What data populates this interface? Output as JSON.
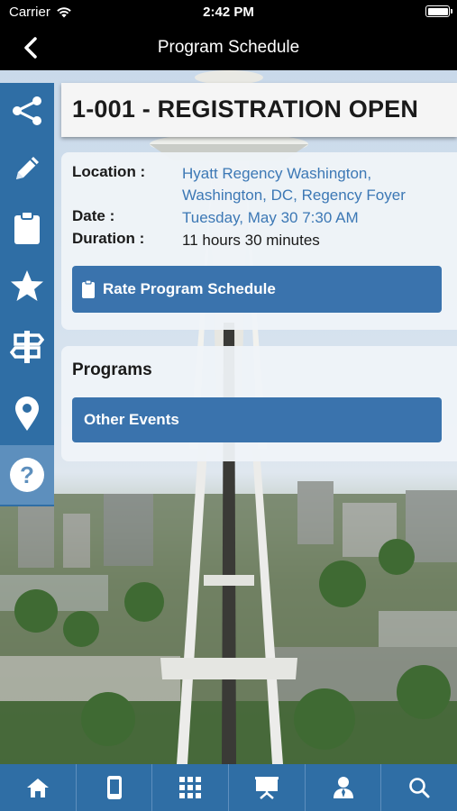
{
  "status_bar": {
    "carrier": "Carrier",
    "time": "2:42 PM"
  },
  "nav": {
    "title": "Program Schedule",
    "back_icon": "chevron-left-icon"
  },
  "side_rail": [
    {
      "icon": "share-icon"
    },
    {
      "icon": "pencil-icon"
    },
    {
      "icon": "clipboard-icon"
    },
    {
      "icon": "star-icon"
    },
    {
      "icon": "signpost-icon"
    },
    {
      "icon": "map-pin-icon"
    },
    {
      "icon": "help-icon",
      "active": true
    }
  ],
  "session": {
    "title": "1-001 - REGISTRATION OPEN",
    "location_label": "Location :",
    "location_value": "Hyatt Regency Washington, Washington, DC, Regency Foyer",
    "date_label": "Date :",
    "date_value": "Tuesday, May 30 7:30 AM",
    "duration_label": "Duration :",
    "duration_value": "11 hours 30 minutes",
    "rate_button": "Rate Program Schedule"
  },
  "programs": {
    "heading": "Programs",
    "other_events_button": "Other Events"
  },
  "tab_bar": [
    {
      "icon": "home-icon"
    },
    {
      "icon": "mobile-icon"
    },
    {
      "icon": "grid-icon"
    },
    {
      "icon": "presentation-icon"
    },
    {
      "icon": "speaker-icon"
    },
    {
      "icon": "search-icon"
    }
  ],
  "colors": {
    "primary": "#3a73ad",
    "rail": "#2f6ea5",
    "rail_active": "#5d8fbd",
    "link": "#3c78b5",
    "bar": "#000000"
  }
}
